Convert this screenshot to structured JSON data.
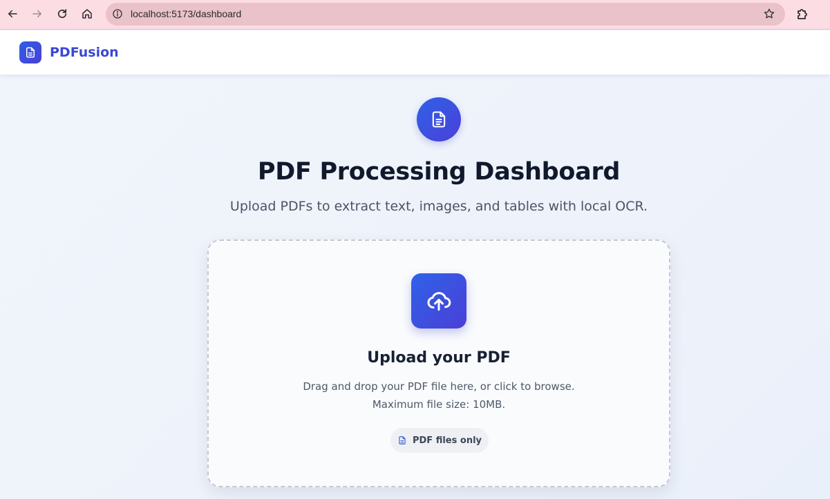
{
  "browser": {
    "url": "localhost:5173/dashboard",
    "icons": [
      "back-icon",
      "forward-icon",
      "reload-icon",
      "home-icon",
      "info-icon",
      "star-icon",
      "extensions-icon"
    ]
  },
  "app": {
    "brand": "PDFusion"
  },
  "hero": {
    "title": "PDF Processing Dashboard",
    "subtitle": "Upload PDFs to extract text, images, and tables with local OCR."
  },
  "upload": {
    "title": "Upload your PDF",
    "description": "Drag and drop your PDF file here, or click to browse. Maximum file size: 10MB.",
    "badge": "PDF files only"
  },
  "colors": {
    "accent": "#3a47d8",
    "gradient_start": "#2f62e8",
    "gradient_end": "#4b3fd8",
    "browser_bar": "#fcdde3"
  }
}
